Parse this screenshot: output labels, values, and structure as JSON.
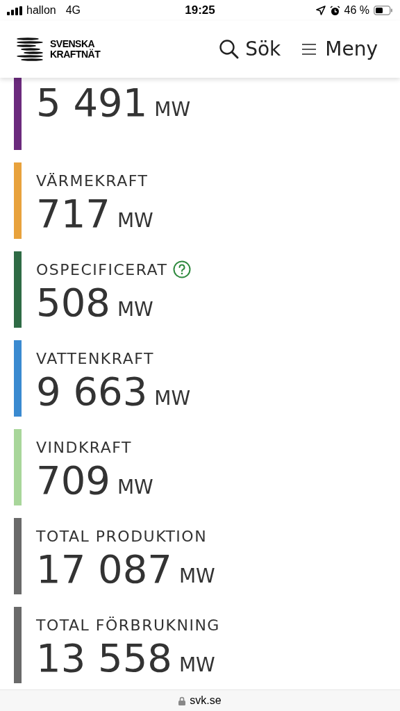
{
  "status_bar": {
    "carrier": "hallon",
    "network": "4G",
    "time": "19:25",
    "battery": "46 %"
  },
  "header": {
    "logo_lines": [
      "SVENSKA",
      "KRAFTNÄT"
    ],
    "search": "Sök",
    "menu": "Meny"
  },
  "items": [
    {
      "value": "5 491",
      "unit": "MW",
      "color": "#6b2a7d"
    },
    {
      "label": "VÄRMEKRAFT",
      "value": "717",
      "unit": "MW",
      "color": "#e8a23c",
      "help": false
    },
    {
      "label": "OSPECIFICERAT",
      "value": "508",
      "unit": "MW",
      "color": "#2f6b45",
      "help": true
    },
    {
      "label": "VATTENKRAFT",
      "value": "9 663",
      "unit": "MW",
      "color": "#3a8ad0",
      "help": false
    },
    {
      "label": "VINDKRAFT",
      "value": "709",
      "unit": "MW",
      "color": "#a8d69a",
      "help": false
    },
    {
      "label": "TOTAL PRODUKTION",
      "value": "17 087",
      "unit": "MW",
      "color": "#6a6a6a",
      "help": false
    },
    {
      "label": "TOTAL FÖRBRUKNING",
      "value": "13 558",
      "unit": "MW",
      "color": "#6a6a6a",
      "help": false
    }
  ],
  "url_bar": {
    "url": "svk.se"
  }
}
